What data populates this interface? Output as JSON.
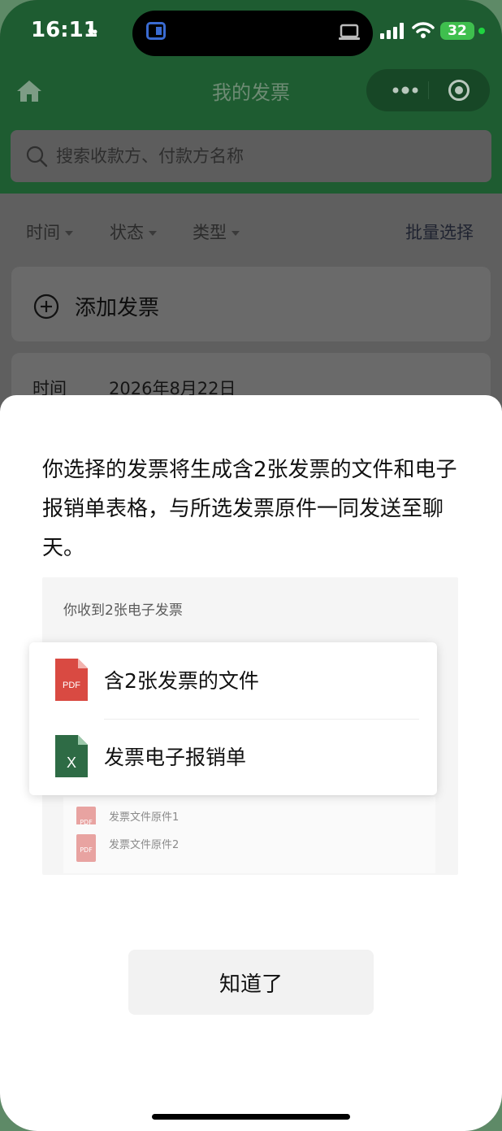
{
  "status": {
    "time": "16:11",
    "battery": "32"
  },
  "nav": {
    "title": "我的发票"
  },
  "search": {
    "placeholder": "搜索收款方、付款方名称"
  },
  "filters": [
    {
      "label": "时间"
    },
    {
      "label": "状态"
    },
    {
      "label": "类型"
    }
  ],
  "batch_label": "批量选择",
  "add_invoice_label": "添加发票",
  "invoice_preview": {
    "time_label": "时间",
    "time_value": "2026年8月22日"
  },
  "dialog": {
    "message": "你选择的发票将生成含2张发票的文件和电子报销单表格，与所选发票原件一同发送至聊天。",
    "preview_header": "你收到2张电子发票",
    "files": [
      {
        "label": "含2张发票的文件",
        "icon": "pdf-icon",
        "color": "#d94a42"
      },
      {
        "label": "发票电子报销单",
        "icon": "excel-icon",
        "color": "#2e6b45"
      }
    ],
    "originals": [
      {
        "label": "发票文件原件1",
        "tag": "PDF"
      },
      {
        "label": "发票文件原件2",
        "tag": "PDF"
      }
    ],
    "ok_label": "知道了"
  }
}
